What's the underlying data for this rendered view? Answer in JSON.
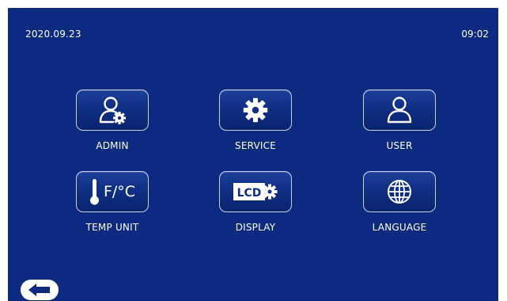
{
  "status": {
    "date": "2020.09.23",
    "time": "09:02"
  },
  "menu": {
    "admin": {
      "label": "ADMIN",
      "icon": "admin-user-gear-icon"
    },
    "service": {
      "label": "SERVICE",
      "icon": "gear-icon"
    },
    "user": {
      "label": "USER",
      "icon": "user-icon"
    },
    "temp_unit": {
      "label": "TEMP UNIT",
      "icon": "thermometer-icon",
      "icon_text": "F/°C"
    },
    "display": {
      "label": "DISPLAY",
      "icon": "lcd-gear-icon",
      "icon_text": "LCD"
    },
    "language": {
      "label": "LANGUAGE",
      "icon": "globe-icon"
    }
  },
  "back": {
    "icon": "back-arrow-icon"
  },
  "colors": {
    "background": "#0c2a80",
    "tile_border": "#c9d2ea",
    "text": "#ffffff"
  }
}
